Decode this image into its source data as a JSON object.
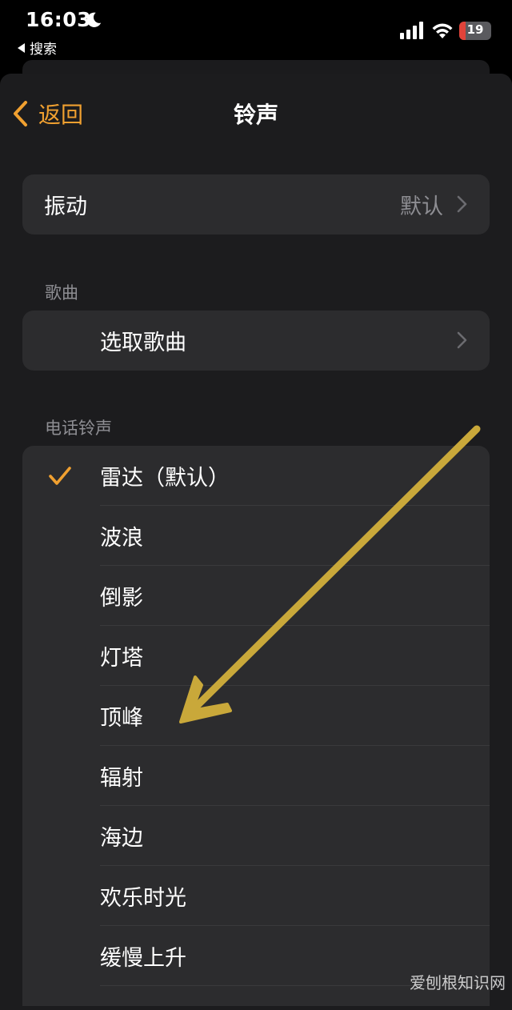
{
  "status_bar": {
    "time": "16:03",
    "back_app": "搜索",
    "battery_level": "19",
    "battery_fraction": 0.19,
    "battery_color": "#e0433a"
  },
  "nav": {
    "back_label": "返回",
    "title": "铃声",
    "accent_color": "#f0a030"
  },
  "vibration": {
    "label": "振动",
    "value": "默认"
  },
  "songs": {
    "header": "歌曲",
    "pick_label": "选取歌曲"
  },
  "ringtones": {
    "header": "电话铃声",
    "items": [
      {
        "label": "雷达（默认）",
        "selected": true
      },
      {
        "label": "波浪",
        "selected": false
      },
      {
        "label": "倒影",
        "selected": false
      },
      {
        "label": "灯塔",
        "selected": false
      },
      {
        "label": "顶峰",
        "selected": false
      },
      {
        "label": "辐射",
        "selected": false
      },
      {
        "label": "海边",
        "selected": false
      },
      {
        "label": "欢乐时光",
        "selected": false
      },
      {
        "label": "缓慢上升",
        "selected": false
      }
    ]
  },
  "annotation": {
    "arrow_color": "#c9a83a"
  },
  "watermark": "爱刨根知识网"
}
